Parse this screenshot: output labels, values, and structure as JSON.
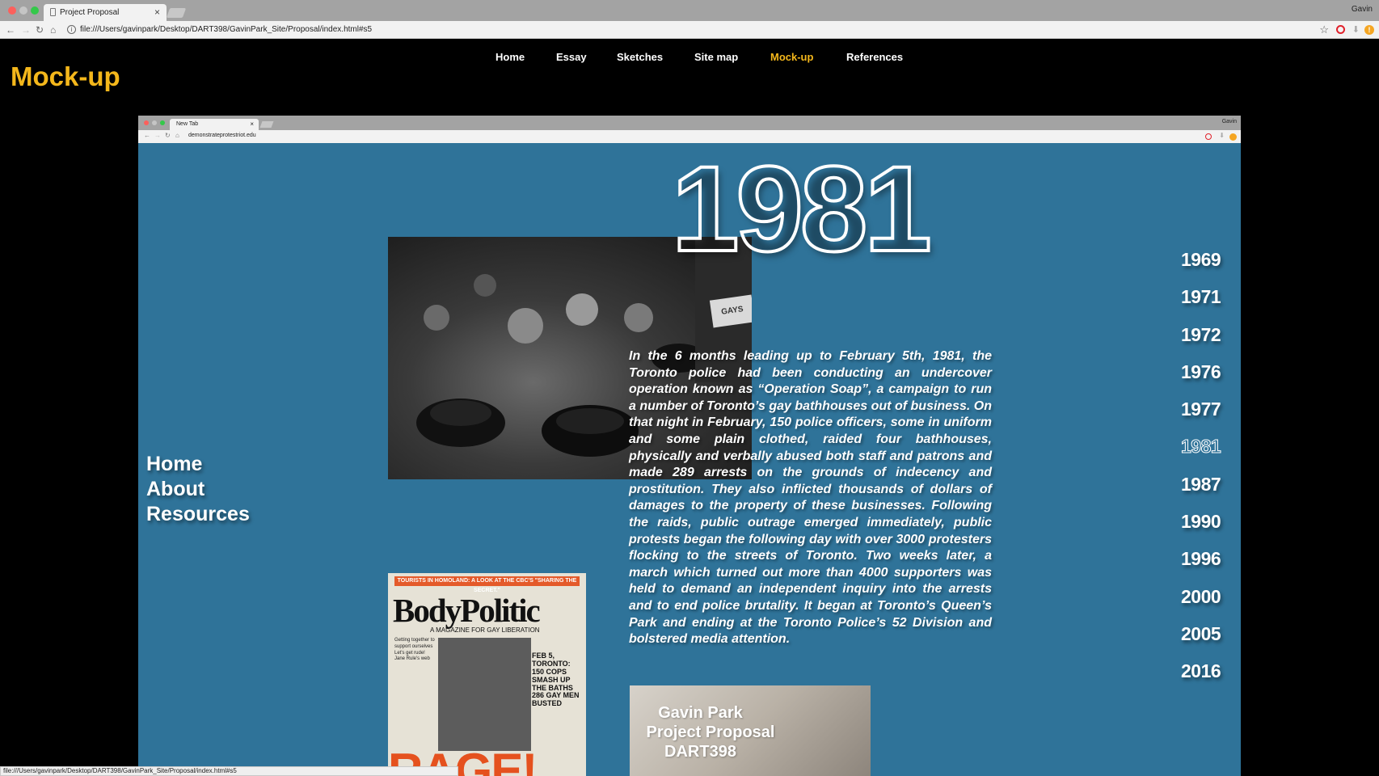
{
  "browser": {
    "tab_title": "Project Proposal",
    "user": "Gavin",
    "url": "file:///Users/gavinpark/Desktop/DART398/GavinPark_Site/Proposal/index.html#s5",
    "status_url": "file:///Users/gavinpark/Desktop/DART398/GavinPark_Site/Proposal/index.html#s5"
  },
  "page": {
    "title": "Mock-up",
    "nav": [
      "Home",
      "Essay",
      "Sketches",
      "Site map",
      "Mock-up",
      "References"
    ],
    "active_nav": "Mock-up",
    "accent": "#f4b71b"
  },
  "mockup": {
    "tab_title": "New Tab",
    "user": "Gavin",
    "url": "demonstrateprotestriot.edu",
    "bg": "#2f7399",
    "year": "1981",
    "side_nav": [
      "Home",
      "About",
      "Resources"
    ],
    "years": [
      "1969",
      "1971",
      "1972",
      "1976",
      "1977",
      "1981",
      "1987",
      "1990",
      "1996",
      "2000",
      "2005",
      "2016"
    ],
    "active_year": "1981",
    "photo_sign": "GAYS",
    "body": "In the 6 months leading up to February 5th, 1981, the Toronto police had been conducting an undercover operation known as “Operation Soap”, a campaign to run a number of Toronto’s gay bathhouses out of business. On that night in February, 150 police officers, some in uniform and some plain clothed, raided four bathhouses, physically and verbally abused both staff and patrons and made 289 arrests on the grounds of indecency and prostitution.  They also inflicted thousands of dollars of damages to the property of these businesses. Following the raids, public outrage emerged immediately, public protests began the following day with over 3000 protesters flocking to the streets of Toronto. Two weeks later, a march which turned out more than 4000 supporters was held to demand an independent inquiry into the arrests and to end police brutality. It began at Toronto’s Queen’s Park and ending at the Toronto Police’s 52 Division and bolstered media attention.",
    "magazine": {
      "banner": "TOURISTS IN HOMOLAND: A LOOK AT THE CBC'S \"SHARING THE SECRET.\"",
      "title": "BodyPolitic",
      "subtitle": "A MAGAZINE FOR GAY LIBERATION",
      "column": "Getting together to support ourselves Let's get rude! Jane Rule's web",
      "headline": "FEB 5, TORONTO: 150 COPS SMASH UP THE BATHS 286 GAY MEN BUSTED",
      "rage": "RAGE!"
    },
    "credit": [
      "Gavin Park",
      "Project Proposal",
      "DART398"
    ]
  }
}
